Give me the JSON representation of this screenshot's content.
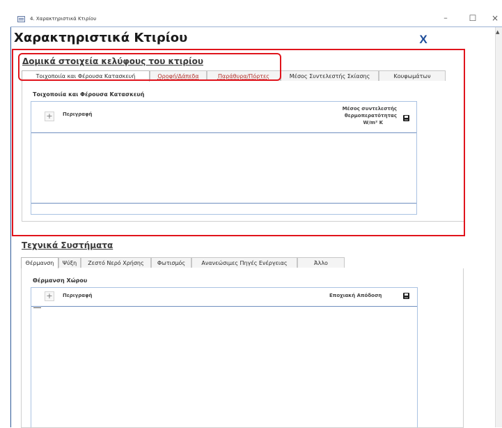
{
  "window": {
    "title": "4. Χαρακτηριστικά Κτιρίου",
    "minimize": "–",
    "maximize": "☐",
    "close": "×"
  },
  "form": {
    "title": "Χαρακτηριστικά Κτιρίου",
    "close_label": "X"
  },
  "shell": {
    "title": "Δομικά στοιχεία κελύφους του κτιρίου",
    "tabs": [
      "Τοιχοποιία και Φέρουσα Κατασκευή",
      "Οροφή/Δάπεδα",
      "Παράθυρα/Πόρτες",
      "Μέσος Συντελεστής Σκίασης",
      "Κουφωμάτων"
    ],
    "active_tab": 0,
    "panel_title": "Τοιχοποιία και Φέρουσα Κατασκευή",
    "grid": {
      "add_label": "+",
      "col_description": "Περιγραφή",
      "col_value_line1": "Μέσος συντελεστής",
      "col_value_line2": "θερμοπερατότητας",
      "col_value_unit": "W/m² K",
      "rows": []
    }
  },
  "systems": {
    "title": "Τεχνικά Συστήματα",
    "tabs": [
      "Θέρμανση",
      "Ψύξη",
      "Ζεστό Νερό Χρήσης",
      "Φωτισμός",
      "Ανανεώσιμες Πηγές Ενέργειας",
      "Άλλο"
    ],
    "active_tab": 0,
    "panel_title": "Θέρμανση Χώρου",
    "grid": {
      "add_label": "+",
      "col_description": "Περιγραφή",
      "col_value": "Εποχιακή Απόδοση",
      "rows": []
    }
  },
  "colors": {
    "annotation": "#e0141c",
    "accent": "#1f4e9a"
  },
  "icons": [
    "app-icon",
    "save-icon",
    "close-icon",
    "plus-icon"
  ]
}
